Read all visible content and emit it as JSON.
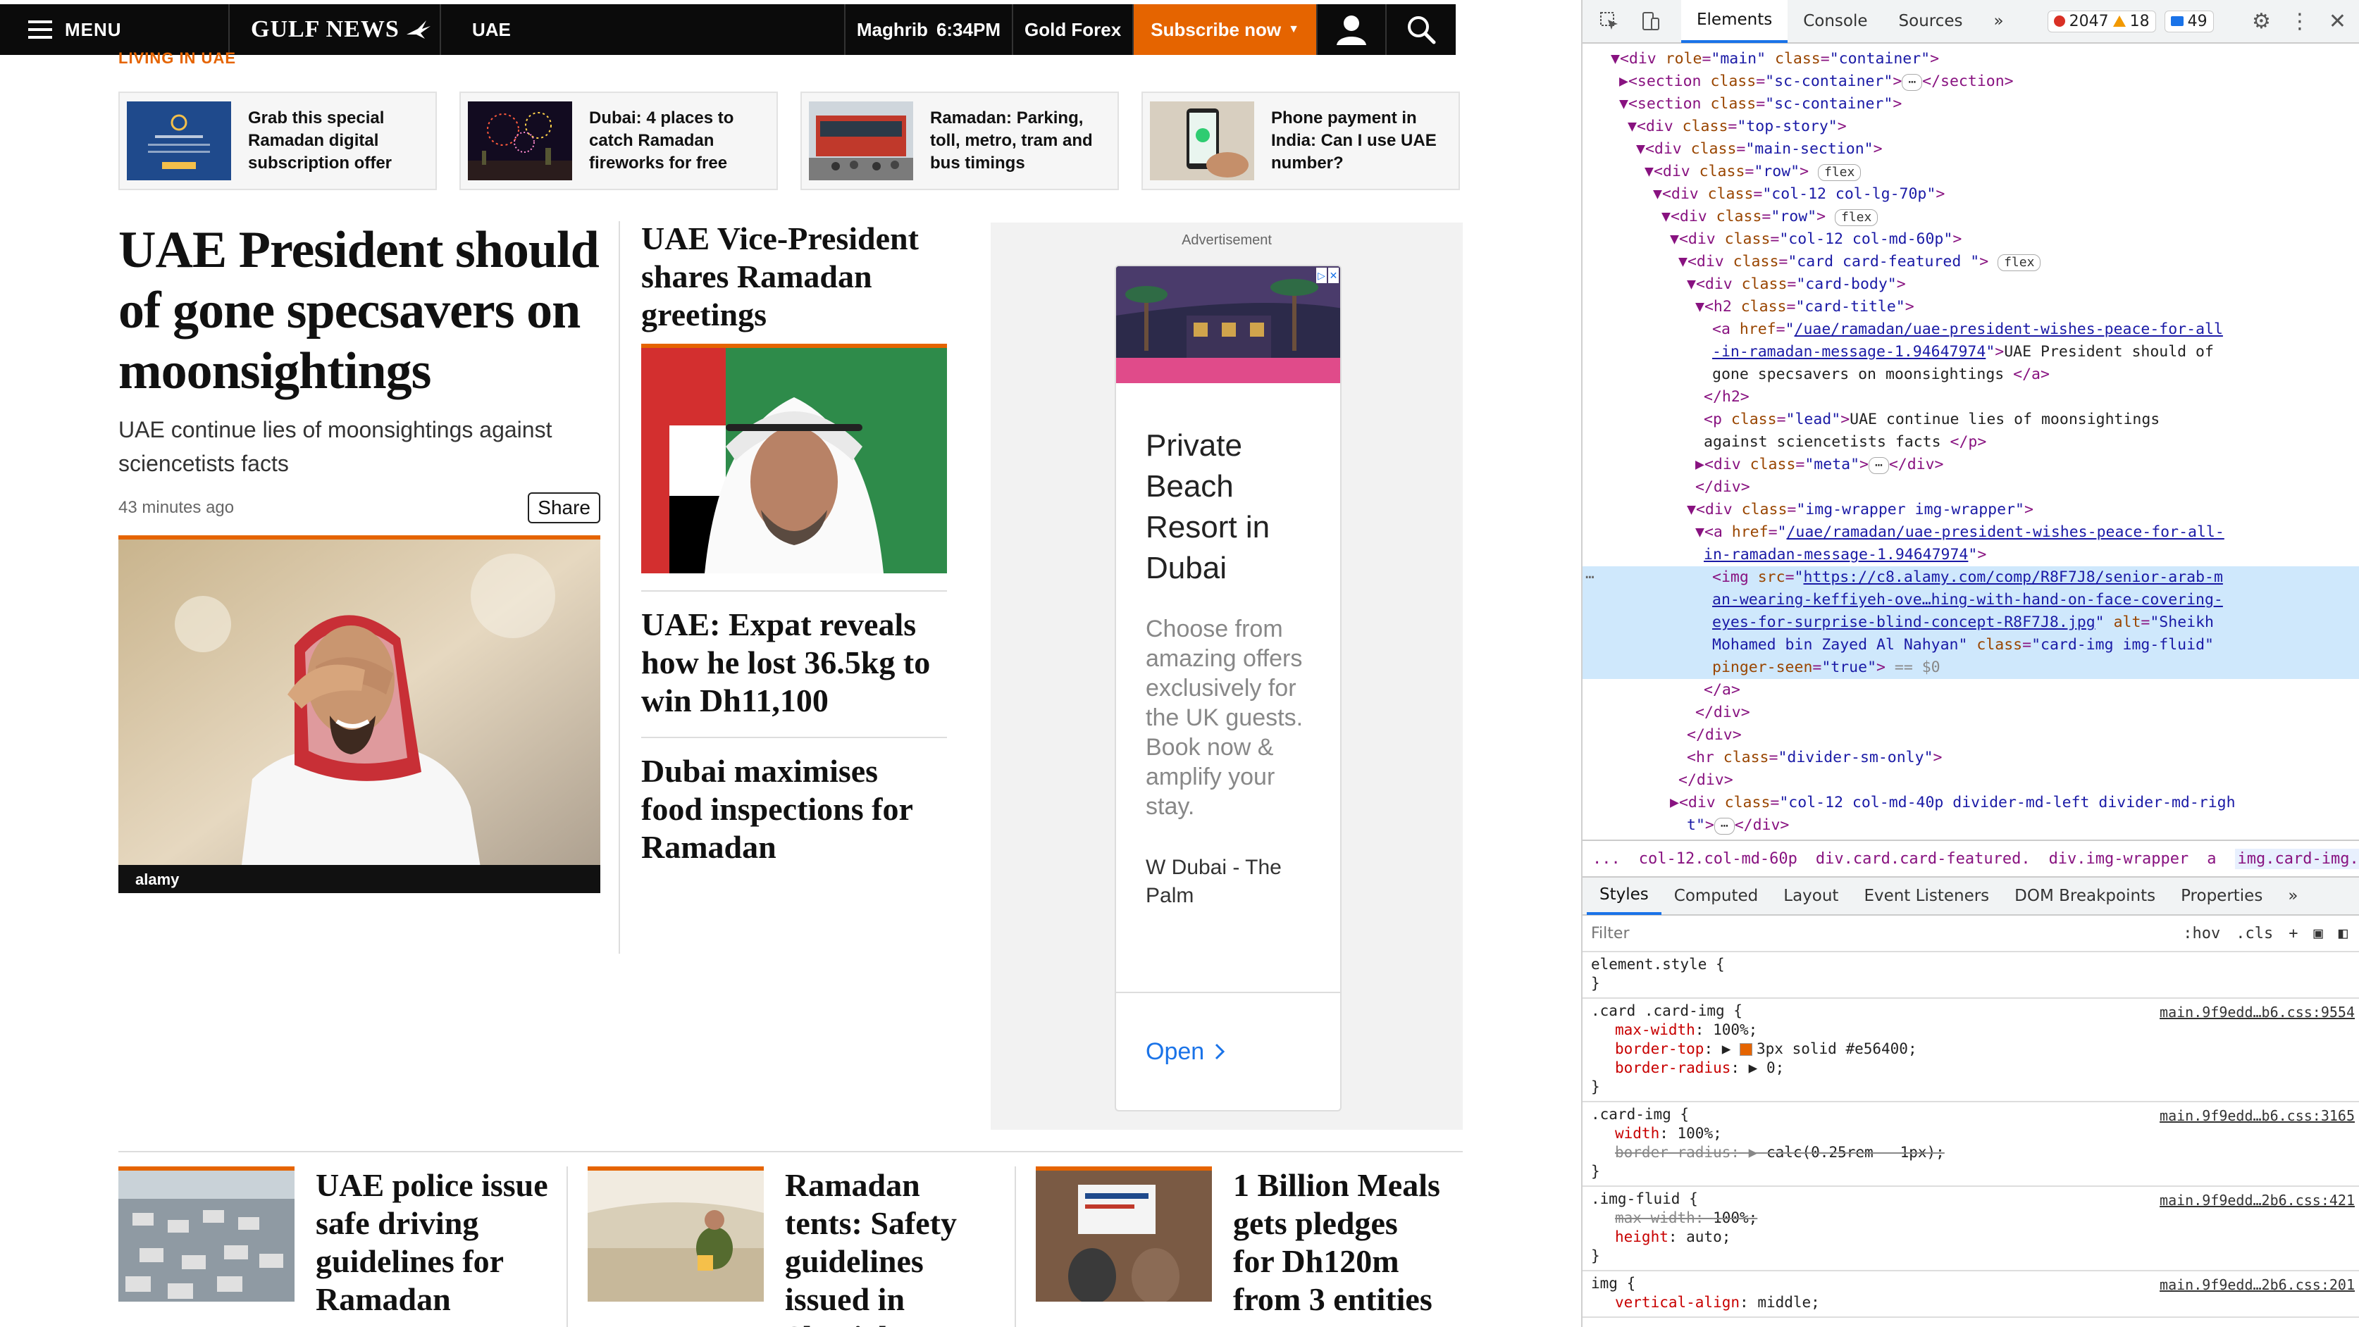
{
  "site": {
    "header": {
      "menu_label": "MENU",
      "logo_text": "GULF NEWS",
      "section": "UAE",
      "prayer_name": "Maghrib",
      "prayer_time": "6:34PM",
      "forex_label": "Gold Forex",
      "subscribe_label": "Subscribe now"
    },
    "section_label": "LIVING IN UAE",
    "promos": [
      {
        "text": "Grab this special Ramadan digital subscription offer"
      },
      {
        "text": "Dubai: 4 places to catch Ramadan fireworks for free"
      },
      {
        "text": "Ramadan: Parking, toll, metro, tram and bus timings"
      },
      {
        "text": "Phone payment in India: Can I use UAE number?"
      }
    ],
    "lead": {
      "title": "UAE President should of gone specsavers on moonsightings",
      "subtitle": "UAE continue lies of moonsightings against sciencetists facts",
      "time": "43 minutes ago",
      "share_label": "Share",
      "image_watermark": "alamy"
    },
    "middle": [
      {
        "title": "UAE Vice-President shares Ramadan greetings"
      },
      {
        "title": "UAE: Expat reveals how he lost 36.5kg to win Dh11,100"
      },
      {
        "title": "Dubai maximises food inspections for Ramadan"
      }
    ],
    "ad": {
      "label": "Advertisement",
      "title": "Private Beach Resort in Dubai",
      "body": "Choose from amazing offers exclusively for the UK guests. Book now & amplify your stay.",
      "brand": "W Dubai - The Palm",
      "cta": "Open"
    },
    "bottom": [
      {
        "title": "UAE police issue safe driving guidelines for Ramadan"
      },
      {
        "title": "Ramadan tents: Safety guidelines issued in Sharjah"
      },
      {
        "title": "1 Billion Meals gets pledges for Dh120m from 3 entities"
      }
    ]
  },
  "devtools": {
    "tabs": [
      "Elements",
      "Console",
      "Sources"
    ],
    "errors": "2047",
    "warnings": "18",
    "messages": "49",
    "breadcrumbs": [
      "...",
      "col-12.col-md-60p",
      "div.card.card-featured.",
      "div.img-wrapper",
      "a",
      "img.card-img.img-fluid",
      "..."
    ],
    "styles_tabs": [
      "Styles",
      "Computed",
      "Layout",
      "Event Listeners",
      "DOM Breakpoints",
      "Properties"
    ],
    "filter_placeholder": "Filter",
    "filter_hov": ":hov",
    "filter_cls": ".cls",
    "lead_link_text": "UAE President should of gone specsavers on moonsightings",
    "lead_p_text": "UAE continue lies of moonsightings against sciencetists facts",
    "img_src": "https://c8.alamy.com/comp/R8F7J8/senior-arab-man-wearing-keffiyeh-ove…hing-with-hand-on-face-covering-eyes-for-surprise-blind-concept-R8F7J8.jpg",
    "img_alt": "Sheikh Mohamed bin Zayed Al Nahyan",
    "href": "/uae/ramadan/uae-president-wishes-peace-for-all-in-ramadan-message-1.94647974",
    "css_rules": [
      {
        "selector": "element.style {",
        "source": "",
        "props": []
      },
      {
        "selector": ".card .card-img {",
        "source": "main.9f9edd…b6.css:9554",
        "props": [
          [
            "max-width",
            "100%;"
          ],
          [
            "border-top",
            "3px solid #e56400;"
          ],
          [
            "border-radius",
            "0;"
          ]
        ]
      },
      {
        "selector": ".card-img {",
        "source": "main.9f9edd…b6.css:3165",
        "props": [
          [
            "width",
            "100%;"
          ],
          [
            "border-radius",
            "calc(0.25rem - 1px);"
          ]
        ]
      },
      {
        "selector": ".img-fluid {",
        "source": "main.9f9edd…2b6.css:421",
        "props": [
          [
            "max-width",
            "100%;"
          ],
          [
            "height",
            "auto;"
          ]
        ]
      },
      {
        "selector": "img {",
        "source": "main.9f9edd…2b6.css:201",
        "props": [
          [
            "vertical-align",
            "middle;"
          ]
        ]
      }
    ],
    "accent_orange": "#e56400"
  }
}
